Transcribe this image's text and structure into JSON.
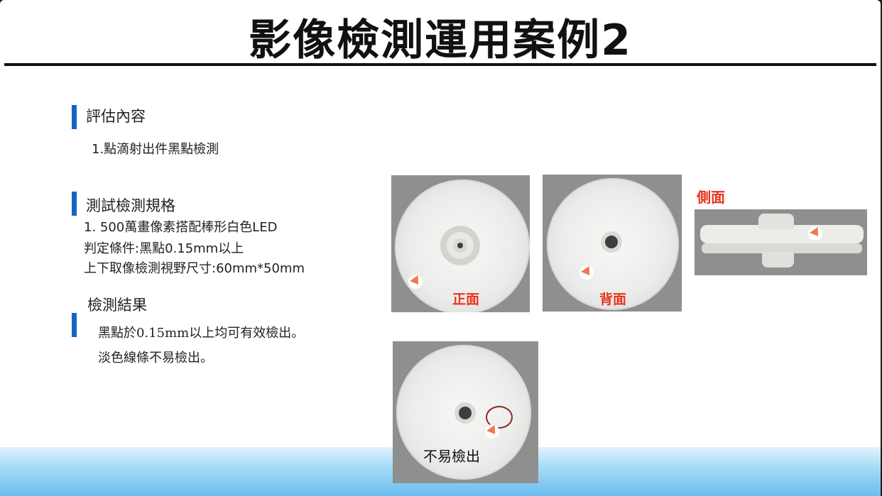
{
  "slide": {
    "title": "影像檢測運用案例2"
  },
  "section_eval": {
    "heading": "評估內容",
    "items": [
      "1.點滴射出件黑點檢測"
    ]
  },
  "section_spec": {
    "heading": "測試檢測規格",
    "items": [
      "1. 500萬畫像素搭配棒形白色LED",
      "判定條件:黑點0.15mm以上",
      "上下取像檢測視野尺寸:60mm*50mm"
    ]
  },
  "section_result": {
    "heading": "檢測結果",
    "items": [
      "黑點於0.15mm以上均可有效檢出。",
      "淡色線條不易檢出。"
    ]
  },
  "images": {
    "front_label": "正面",
    "back_label": "背面",
    "side_label": "側面",
    "hard_label": "不易檢出"
  },
  "colors": {
    "accent_bar": "#1565c0",
    "label_red": "#e8341c",
    "arrow": "#f07a4a"
  }
}
